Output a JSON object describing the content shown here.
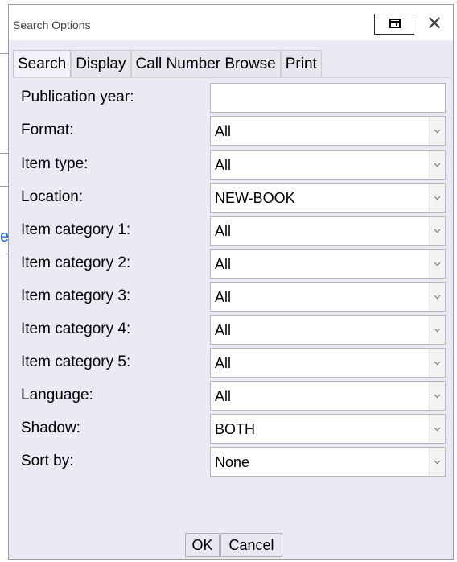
{
  "window": {
    "title": "Search Options"
  },
  "tabs": [
    {
      "label": "Search",
      "active": true
    },
    {
      "label": "Display",
      "active": false
    },
    {
      "label": "Call Number Browse",
      "active": false
    },
    {
      "label": "Print",
      "active": false
    }
  ],
  "fields": {
    "publication_year": {
      "label": "Publication year:",
      "value": "",
      "type": "text"
    },
    "format": {
      "label": "Format:",
      "value": "All",
      "type": "select"
    },
    "item_type": {
      "label": "Item type:",
      "value": "All",
      "type": "select"
    },
    "location": {
      "label": "Location:",
      "value": "NEW-BOOK",
      "type": "select"
    },
    "item_category_1": {
      "label": "Item category 1:",
      "value": "All",
      "type": "select"
    },
    "item_category_2": {
      "label": "Item category 2:",
      "value": "All",
      "type": "select"
    },
    "item_category_3": {
      "label": "Item category 3:",
      "value": "All",
      "type": "select"
    },
    "item_category_4": {
      "label": "Item category 4:",
      "value": "All",
      "type": "select"
    },
    "item_category_5": {
      "label": "Item category 5:",
      "value": "All",
      "type": "select"
    },
    "language": {
      "label": "Language:",
      "value": "All",
      "type": "select"
    },
    "shadow": {
      "label": "Shadow:",
      "value": "BOTH",
      "type": "select"
    },
    "sort_by": {
      "label": "Sort by:",
      "value": "None",
      "type": "select"
    }
  },
  "buttons": {
    "ok": "OK",
    "cancel": "Cancel"
  },
  "icons": {
    "restore": "restore-window-icon",
    "close": "close-icon",
    "dropdown": "chevron-down-icon"
  },
  "colors": {
    "content_background": "#ece9f5",
    "link_blue": "#2563c9"
  }
}
